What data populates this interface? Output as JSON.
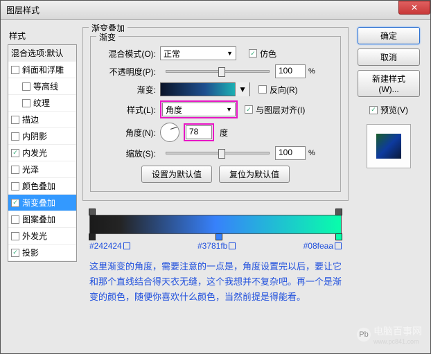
{
  "window": {
    "title": "图层样式"
  },
  "sidebar": {
    "title": "样式",
    "blend_header": "混合选项:默认",
    "items": [
      {
        "label": "斜面和浮雕",
        "checked": false,
        "indent": false
      },
      {
        "label": "等高线",
        "checked": false,
        "indent": true
      },
      {
        "label": "纹理",
        "checked": false,
        "indent": true
      },
      {
        "label": "描边",
        "checked": false,
        "indent": false
      },
      {
        "label": "内阴影",
        "checked": false,
        "indent": false
      },
      {
        "label": "内发光",
        "checked": true,
        "indent": false
      },
      {
        "label": "光泽",
        "checked": false,
        "indent": false
      },
      {
        "label": "颜色叠加",
        "checked": false,
        "indent": false
      },
      {
        "label": "渐变叠加",
        "checked": true,
        "indent": false,
        "selected": true
      },
      {
        "label": "图案叠加",
        "checked": false,
        "indent": false
      },
      {
        "label": "外发光",
        "checked": false,
        "indent": false
      },
      {
        "label": "投影",
        "checked": true,
        "indent": false
      }
    ]
  },
  "panel": {
    "title": "渐变叠加",
    "group_title": "渐变",
    "blend_mode_label": "混合模式(O):",
    "blend_mode_value": "正常",
    "dither_label": "仿色",
    "opacity_label": "不透明度(P):",
    "opacity_value": "100",
    "gradient_label": "渐变:",
    "reverse_label": "反向(R)",
    "style_label": "样式(L):",
    "style_value": "角度",
    "align_label": "与图层对齐(I)",
    "angle_label": "角度(N):",
    "angle_value": "78",
    "angle_unit": "度",
    "scale_label": "缩放(S):",
    "scale_value": "100",
    "pct": "%",
    "btn_default": "设置为默认值",
    "btn_reset": "复位为默认值"
  },
  "buttons": {
    "ok": "确定",
    "cancel": "取消",
    "new_style": "新建样式(W)...",
    "preview": "预览(V)"
  },
  "annotation": {
    "hex1": "#242424",
    "hex2": "#3781fb",
    "hex3": "#08feaa",
    "note": "这里渐变的角度，需要注意的一点是，角度设置完以后，要让它和那个直线结合得天衣无缝，这个我想并不复杂吧。再一个是渐变的颜色，随便你喜欢什么颜色，当然前提是得能看。"
  },
  "watermark": {
    "brand": "电脑百事网",
    "url": "www.pc841.com",
    "icon": "Pb"
  }
}
